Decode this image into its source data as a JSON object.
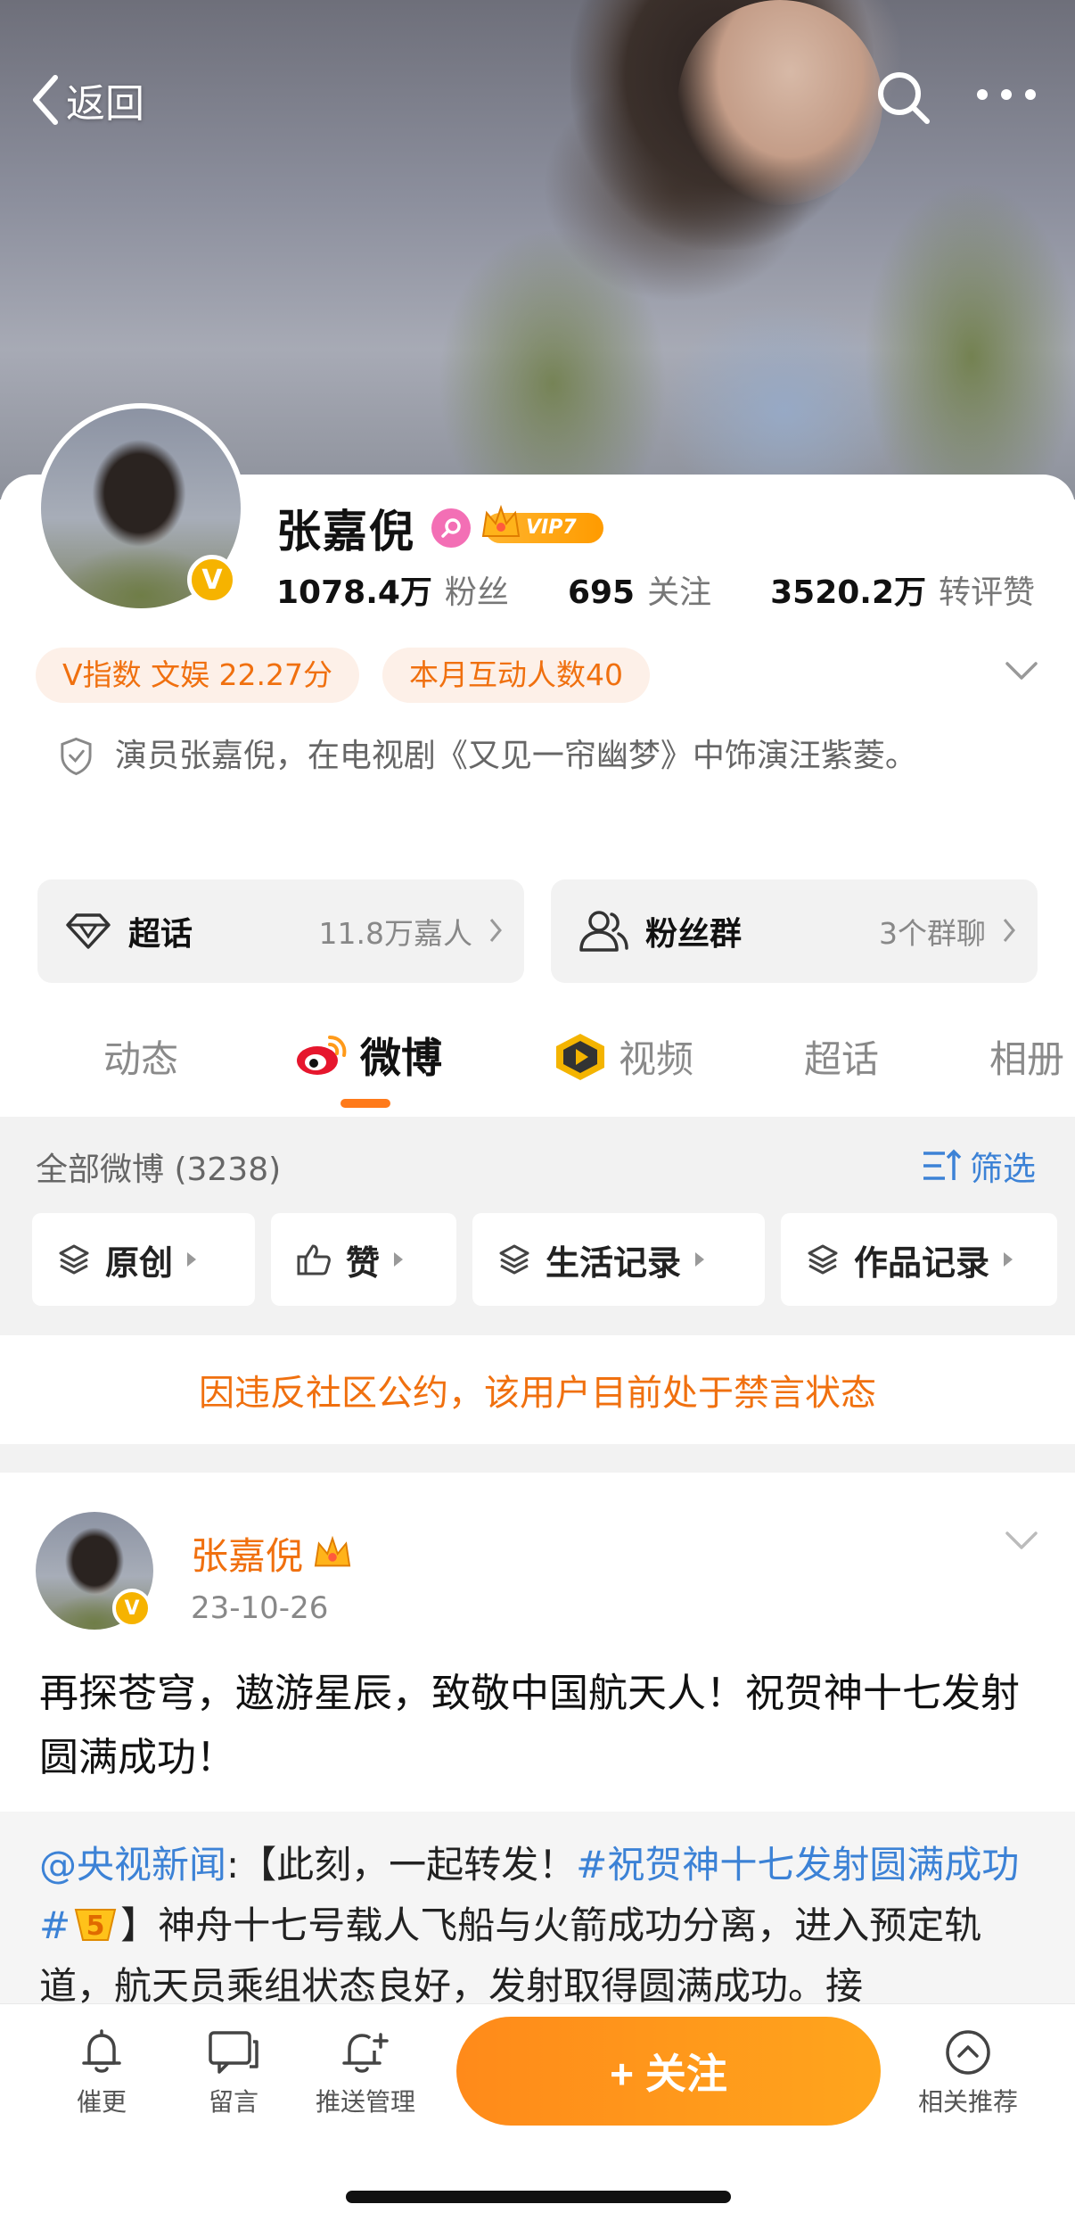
{
  "topbar": {
    "back_label": "返回"
  },
  "profile": {
    "name": "张嘉倪",
    "vip_level": "VIP7",
    "verified_mark": "V",
    "stats": [
      {
        "num": "1078.4万",
        "label": "粉丝"
      },
      {
        "num": "695",
        "label": "关注"
      },
      {
        "num": "3520.2万",
        "label": "转评赞"
      }
    ],
    "tags": [
      "V指数 文娱 22.27分",
      "本月互动人数40"
    ],
    "bio": "演员张嘉倪，在电视剧《又见一帘幽梦》中饰演汪紫菱。"
  },
  "quick_links": [
    {
      "label": "超话",
      "extra": "11.8万嘉人",
      "icon": "diamond-icon"
    },
    {
      "label": "粉丝群",
      "extra": "3个群聊",
      "icon": "group-icon"
    }
  ],
  "tabs": [
    "动态",
    "微博",
    "视频",
    "超话",
    "相册"
  ],
  "filter": {
    "title": "全部微博 (3238)",
    "filter_label": "筛选",
    "chips": [
      "原创",
      "赞",
      "生活记录",
      "作品记录"
    ]
  },
  "ban_notice": "因违反社区公约，该用户目前处于禁言状态",
  "post": {
    "author": "张嘉倪",
    "time": "23-10-26",
    "text": "再探苍穹，遨游星辰，致敬中国航天人！祝贺神十七发射圆满成功！",
    "repost": {
      "source": "@央视新闻",
      "prefix": ":【此刻，一起转发！",
      "hashtag": "#祝贺神十七发射圆满成功#",
      "body": "】神舟十七号载人飞船与火箭成功分离，进入预定轨道，航天员乘组状态良好，发射取得圆满成功。接"
    }
  },
  "bottom_bar": {
    "items": [
      "催更",
      "留言",
      "推送管理"
    ],
    "follow_label": "+ 关注",
    "recommend_label": "相关推荐"
  },
  "colors": {
    "accent": "#f0700f",
    "link": "#3c82d6",
    "vip": "#ffa51c"
  }
}
